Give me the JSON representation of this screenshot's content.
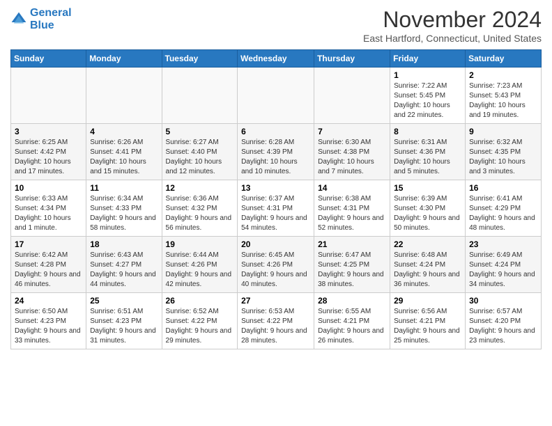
{
  "header": {
    "logo_line1": "General",
    "logo_line2": "Blue",
    "month": "November 2024",
    "location": "East Hartford, Connecticut, United States"
  },
  "columns": [
    "Sunday",
    "Monday",
    "Tuesday",
    "Wednesday",
    "Thursday",
    "Friday",
    "Saturday"
  ],
  "weeks": [
    [
      {
        "day": "",
        "info": ""
      },
      {
        "day": "",
        "info": ""
      },
      {
        "day": "",
        "info": ""
      },
      {
        "day": "",
        "info": ""
      },
      {
        "day": "",
        "info": ""
      },
      {
        "day": "1",
        "info": "Sunrise: 7:22 AM\nSunset: 5:45 PM\nDaylight: 10 hours and 22 minutes."
      },
      {
        "day": "2",
        "info": "Sunrise: 7:23 AM\nSunset: 5:43 PM\nDaylight: 10 hours and 19 minutes."
      }
    ],
    [
      {
        "day": "3",
        "info": "Sunrise: 6:25 AM\nSunset: 4:42 PM\nDaylight: 10 hours and 17 minutes."
      },
      {
        "day": "4",
        "info": "Sunrise: 6:26 AM\nSunset: 4:41 PM\nDaylight: 10 hours and 15 minutes."
      },
      {
        "day": "5",
        "info": "Sunrise: 6:27 AM\nSunset: 4:40 PM\nDaylight: 10 hours and 12 minutes."
      },
      {
        "day": "6",
        "info": "Sunrise: 6:28 AM\nSunset: 4:39 PM\nDaylight: 10 hours and 10 minutes."
      },
      {
        "day": "7",
        "info": "Sunrise: 6:30 AM\nSunset: 4:38 PM\nDaylight: 10 hours and 7 minutes."
      },
      {
        "day": "8",
        "info": "Sunrise: 6:31 AM\nSunset: 4:36 PM\nDaylight: 10 hours and 5 minutes."
      },
      {
        "day": "9",
        "info": "Sunrise: 6:32 AM\nSunset: 4:35 PM\nDaylight: 10 hours and 3 minutes."
      }
    ],
    [
      {
        "day": "10",
        "info": "Sunrise: 6:33 AM\nSunset: 4:34 PM\nDaylight: 10 hours and 1 minute."
      },
      {
        "day": "11",
        "info": "Sunrise: 6:34 AM\nSunset: 4:33 PM\nDaylight: 9 hours and 58 minutes."
      },
      {
        "day": "12",
        "info": "Sunrise: 6:36 AM\nSunset: 4:32 PM\nDaylight: 9 hours and 56 minutes."
      },
      {
        "day": "13",
        "info": "Sunrise: 6:37 AM\nSunset: 4:31 PM\nDaylight: 9 hours and 54 minutes."
      },
      {
        "day": "14",
        "info": "Sunrise: 6:38 AM\nSunset: 4:31 PM\nDaylight: 9 hours and 52 minutes."
      },
      {
        "day": "15",
        "info": "Sunrise: 6:39 AM\nSunset: 4:30 PM\nDaylight: 9 hours and 50 minutes."
      },
      {
        "day": "16",
        "info": "Sunrise: 6:41 AM\nSunset: 4:29 PM\nDaylight: 9 hours and 48 minutes."
      }
    ],
    [
      {
        "day": "17",
        "info": "Sunrise: 6:42 AM\nSunset: 4:28 PM\nDaylight: 9 hours and 46 minutes."
      },
      {
        "day": "18",
        "info": "Sunrise: 6:43 AM\nSunset: 4:27 PM\nDaylight: 9 hours and 44 minutes."
      },
      {
        "day": "19",
        "info": "Sunrise: 6:44 AM\nSunset: 4:26 PM\nDaylight: 9 hours and 42 minutes."
      },
      {
        "day": "20",
        "info": "Sunrise: 6:45 AM\nSunset: 4:26 PM\nDaylight: 9 hours and 40 minutes."
      },
      {
        "day": "21",
        "info": "Sunrise: 6:47 AM\nSunset: 4:25 PM\nDaylight: 9 hours and 38 minutes."
      },
      {
        "day": "22",
        "info": "Sunrise: 6:48 AM\nSunset: 4:24 PM\nDaylight: 9 hours and 36 minutes."
      },
      {
        "day": "23",
        "info": "Sunrise: 6:49 AM\nSunset: 4:24 PM\nDaylight: 9 hours and 34 minutes."
      }
    ],
    [
      {
        "day": "24",
        "info": "Sunrise: 6:50 AM\nSunset: 4:23 PM\nDaylight: 9 hours and 33 minutes."
      },
      {
        "day": "25",
        "info": "Sunrise: 6:51 AM\nSunset: 4:23 PM\nDaylight: 9 hours and 31 minutes."
      },
      {
        "day": "26",
        "info": "Sunrise: 6:52 AM\nSunset: 4:22 PM\nDaylight: 9 hours and 29 minutes."
      },
      {
        "day": "27",
        "info": "Sunrise: 6:53 AM\nSunset: 4:22 PM\nDaylight: 9 hours and 28 minutes."
      },
      {
        "day": "28",
        "info": "Sunrise: 6:55 AM\nSunset: 4:21 PM\nDaylight: 9 hours and 26 minutes."
      },
      {
        "day": "29",
        "info": "Sunrise: 6:56 AM\nSunset: 4:21 PM\nDaylight: 9 hours and 25 minutes."
      },
      {
        "day": "30",
        "info": "Sunrise: 6:57 AM\nSunset: 4:20 PM\nDaylight: 9 hours and 23 minutes."
      }
    ]
  ]
}
